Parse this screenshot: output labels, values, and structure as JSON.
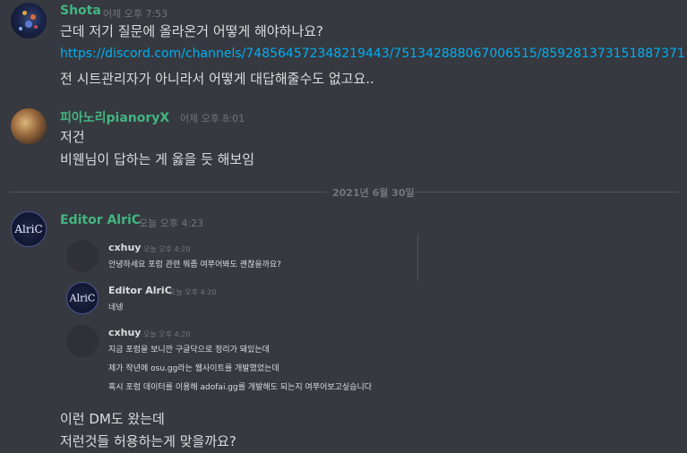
{
  "messages": [
    {
      "author": "Shota",
      "timestamp": "어제 오후 7:53",
      "lines": [
        "근데 저기 질문에 올라온거 어떻게 해야하나요?",
        "https://discord.com/channels/748564572348219443/751342888067006515/859281373151887371",
        "전 시트관리자가 아니라서 어떻게 대답해줄수도 없고요.."
      ]
    },
    {
      "author": "피아노리pianoryX",
      "timestamp": "어제 오후 8:01",
      "lines": [
        "저건",
        "비웬님이 답하는 게 옳을 듯 해보임"
      ]
    }
  ],
  "date_divider": "2021년 6월 30일",
  "alric_message": {
    "author": "Editor AlriC",
    "timestamp": "오늘 오후 4:23",
    "avatar_text": "AlriC",
    "quoted": [
      {
        "author": "cxhuy",
        "timestamp": "오늘 오후 4:20",
        "lines": [
          "안녕하세요 포럼 관련 뭐좀 여쭈어봐도 괜찮을까요?"
        ]
      },
      {
        "author": "Editor AlriC",
        "timestamp": "오늘 오후 4:20",
        "avatar_text": "AlriC",
        "lines": [
          "네넹"
        ]
      },
      {
        "author": "cxhuy",
        "timestamp": "오늘 오후 4:20",
        "lines": [
          "지금 포럼을 보니깐 구글닥으로 정리가 돼있는데",
          "제가 작년에 osu.gg라는 웹사이트를 개발했었는데",
          "혹시 포럼 데이터를 이용해 adofai.gg를 개발해도 되는지 여쭈어보고싶습니다"
        ]
      }
    ],
    "lines": [
      "이런 DM도 왔는데",
      "저런것들 허용하는게 맞을까요?"
    ]
  },
  "colors": {
    "background": "#36393f",
    "author_green": "#43b581",
    "link": "#00aff4",
    "text": "#dcddde",
    "muted": "#72767d"
  }
}
